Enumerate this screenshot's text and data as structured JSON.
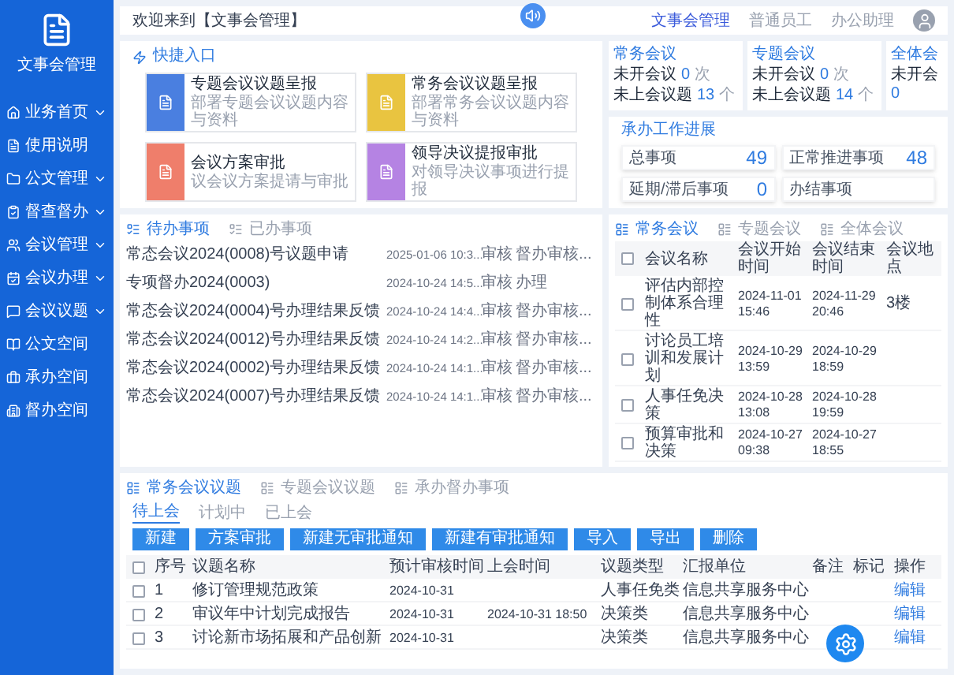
{
  "header": {
    "welcome": "欢迎来到【文事会管理】",
    "roles": [
      {
        "label": "文事会管理",
        "selected": true
      },
      {
        "label": "普通员工",
        "selected": false
      },
      {
        "label": "办公助理",
        "selected": false
      }
    ]
  },
  "sidebar": {
    "app_name": "文事会管理",
    "items": [
      {
        "label": "业务首页",
        "expandable": true
      },
      {
        "label": "使用说明",
        "expandable": false
      },
      {
        "label": "公文管理",
        "expandable": true
      },
      {
        "label": "督查督办",
        "expandable": true
      },
      {
        "label": "会议管理",
        "expandable": true
      },
      {
        "label": "会议办理",
        "expandable": true
      },
      {
        "label": "会议议题",
        "expandable": true
      },
      {
        "label": "公文空间",
        "expandable": false
      },
      {
        "label": "承办空间",
        "expandable": false
      },
      {
        "label": "督办空间",
        "expandable": false
      }
    ]
  },
  "quick_entry": {
    "title": "快捷入口",
    "tiles": [
      {
        "title": "专题会议议题呈报",
        "subtitle": "部署专题会议议题内容与资料",
        "color": "#4a7fe0"
      },
      {
        "title": "常务会议议题呈报",
        "subtitle": "部署常务会议议题内容与资料",
        "color": "#e9c440"
      },
      {
        "title": "会议方案审批",
        "subtitle": "议会议方案提请与审批",
        "color": "#ef7e6b"
      },
      {
        "title": "领导决议提报审批",
        "subtitle": "对领导决议事项进行提报",
        "color": "#b583e3"
      }
    ]
  },
  "meeting_stats": [
    {
      "title": "常务会议",
      "stats": [
        {
          "label": "未开会议",
          "value": "0",
          "unit": "次"
        },
        {
          "label": "未上会议题",
          "value": "13",
          "unit": "个"
        }
      ]
    },
    {
      "title": "专题会议",
      "stats": [
        {
          "label": "未开会议",
          "value": "0",
          "unit": "次"
        },
        {
          "label": "未上会议题",
          "value": "14",
          "unit": "个"
        }
      ]
    },
    {
      "title": "全体会",
      "stats": [
        {
          "label": "未开会",
          "value": "0"
        }
      ]
    }
  ],
  "progress": {
    "title": "承办工作进展",
    "items": [
      {
        "label": "总事项",
        "value": "49"
      },
      {
        "label": "正常推进事项",
        "value": "48"
      },
      {
        "label": "延期/滞后事项",
        "value": "0"
      },
      {
        "label": "办结事项"
      }
    ]
  },
  "todo": {
    "tabs": [
      {
        "label": "待办事项",
        "selected": true
      },
      {
        "label": "已办事项",
        "selected": false
      }
    ],
    "rows": [
      {
        "title": "常态会议2024(0008)号议题申请",
        "time": "2025-01-06 10:3...",
        "type": "审核",
        "status": "督办审核..."
      },
      {
        "title": "专项督办2024(0003)",
        "time": "2024-10-24 14:5...",
        "type": "审核",
        "status": "办理"
      },
      {
        "title": "常态会议2024(0004)号办理结果反馈",
        "time": "2024-10-24 14:4...",
        "type": "审核",
        "status": "督办审核..."
      },
      {
        "title": "常态会议2024(0012)号办理结果反馈",
        "time": "2024-10-24 14:2...",
        "type": "审核",
        "status": "督办审核..."
      },
      {
        "title": "常态会议2024(0002)号办理结果反馈",
        "time": "2024-10-24 14:1...",
        "type": "审核",
        "status": "督办审核..."
      },
      {
        "title": "常态会议2024(0007)号办理结果反馈",
        "time": "2024-10-24 14:1...",
        "type": "审核",
        "status": "督办审核..."
      }
    ]
  },
  "meetings": {
    "tabs": [
      {
        "label": "常务会议",
        "selected": true
      },
      {
        "label": "专题会议",
        "selected": false
      },
      {
        "label": "全体会议",
        "selected": false
      }
    ],
    "header_checked": false,
    "columns": [
      "会议名称",
      "会议开始时间",
      "会议结束时间",
      "会议地点"
    ],
    "rows": [
      {
        "checked": false,
        "cells": [
          "评估内部控制体系合理性",
          "2024-11-01 15:46",
          "2024-11-29 20:46",
          "3楼"
        ]
      },
      {
        "checked": false,
        "cells": [
          "讨论员工培训和发展计划",
          "2024-10-29 13:59",
          "2024-10-29 18:59"
        ]
      },
      {
        "checked": false,
        "cells": [
          "人事任免决策",
          "2024-10-28 13:08",
          "2024-10-28 19:59"
        ]
      },
      {
        "checked": false,
        "cells": [
          "预算审批和决策",
          "2024-10-27 09:38",
          "2024-10-27 18:55"
        ]
      }
    ]
  },
  "topics": {
    "tabs": [
      {
        "label": "常务会议议题",
        "selected": true
      },
      {
        "label": "专题会议议题",
        "selected": false
      },
      {
        "label": "承办督办事项",
        "selected": false
      }
    ],
    "subtabs": [
      {
        "label": "待上会",
        "selected": true
      },
      {
        "label": "计划中",
        "selected": false
      },
      {
        "label": "已上会",
        "selected": false
      }
    ],
    "buttons": [
      "新建",
      "方案审批",
      "新建无审批通知",
      "新建有审批通知",
      "导入",
      "导出",
      "删除"
    ],
    "header_checked": false,
    "columns": [
      "序号",
      "议题名称",
      "预计审核时间",
      "上会时间",
      "议题类型",
      "汇报单位",
      "备注",
      "标记",
      "操作"
    ],
    "rows": [
      {
        "checked": false,
        "cells": [
          "1",
          "修订管理规范政策",
          "2024-10-31",
          null,
          "人事任免类",
          "信息共享服务中心",
          null,
          null,
          "编辑"
        ]
      },
      {
        "checked": false,
        "cells": [
          "2",
          "审议年中计划完成报告",
          "2024-10-31",
          "2024-10-31 18:50",
          "决策类",
          "信息共享服务中心",
          null,
          null,
          "编辑"
        ]
      },
      {
        "checked": false,
        "cells": [
          "3",
          "讨论新市场拓展和产品创新",
          "2024-10-31",
          null,
          "决策类",
          "信息共享服务中心",
          null,
          null,
          "编辑"
        ]
      }
    ]
  }
}
